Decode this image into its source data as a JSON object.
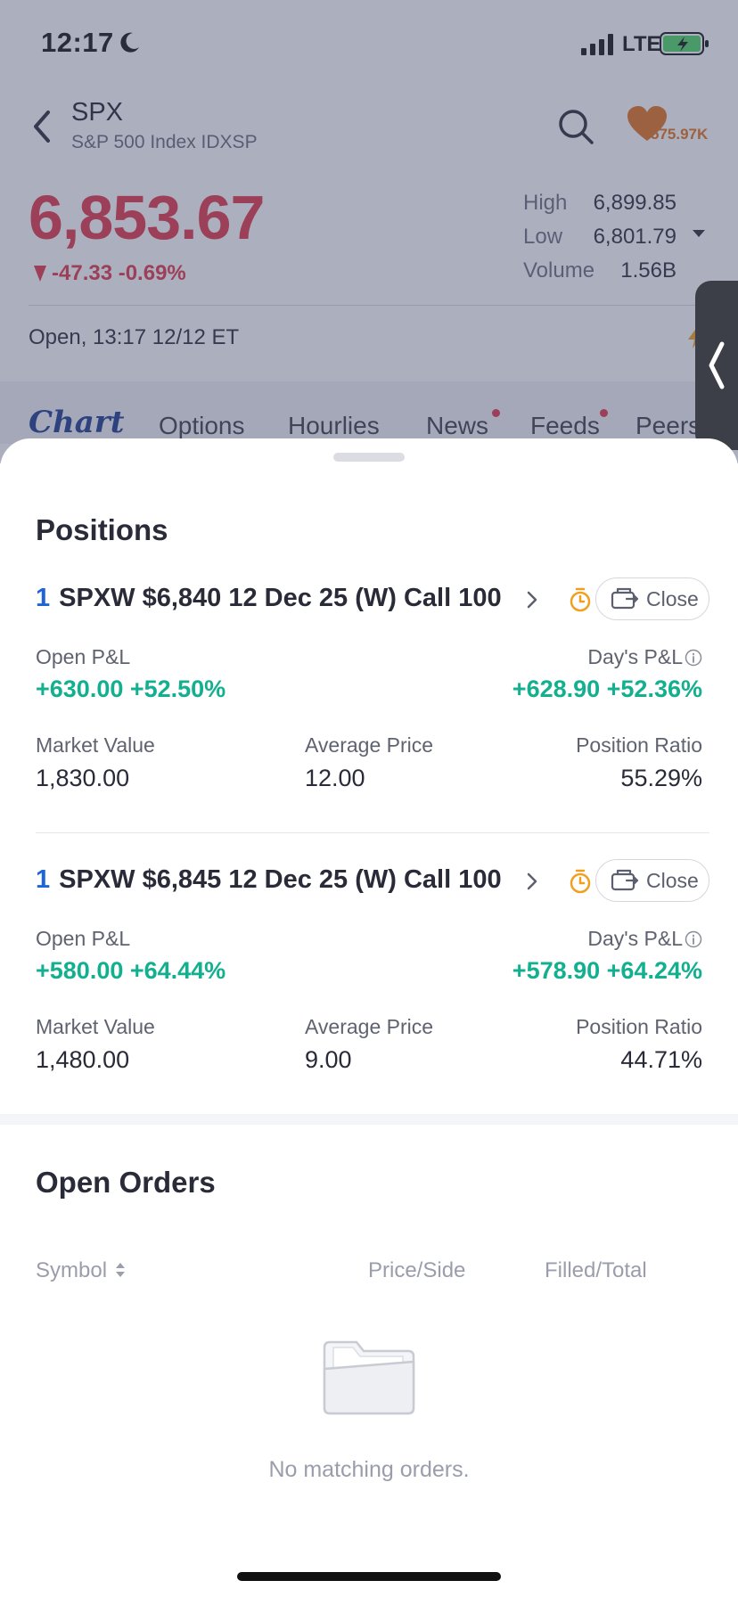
{
  "status_bar": {
    "time": "12:17",
    "network": "LTE"
  },
  "header": {
    "symbol": "SPX",
    "name": "S&P 500 Index IDXSP",
    "followers": "575.97K"
  },
  "quote": {
    "price": "6,853.67",
    "change": "-47.33 -0.69%",
    "stats": [
      {
        "label": "High",
        "value": "6,899.85"
      },
      {
        "label": "Low",
        "value": "6,801.79"
      },
      {
        "label": "Volume",
        "value": "1.56B"
      }
    ],
    "session": "Open, 13:17 12/12 ET"
  },
  "tabs": [
    "Chart",
    "Options",
    "Hourlies",
    "News",
    "Feeds",
    "Peers"
  ],
  "positions": {
    "title": "Positions",
    "items": [
      {
        "qty": "1",
        "contract": "SPXW $6,840 12 Dec 25 (W) Call 100",
        "close_label": "Close",
        "open_pl_label": "Open P&L",
        "open_pl": "+630.00 +52.50%",
        "days_pl_label": "Day's P&L",
        "days_pl": "+628.90 +52.36%",
        "market_value_label": "Market Value",
        "market_value": "1,830.00",
        "avg_price_label": "Average Price",
        "avg_price": "12.00",
        "ratio_label": "Position Ratio",
        "ratio": "55.29%"
      },
      {
        "qty": "1",
        "contract": "SPXW $6,845 12 Dec 25 (W) Call 100",
        "close_label": "Close",
        "open_pl_label": "Open P&L",
        "open_pl": "+580.00 +64.44%",
        "days_pl_label": "Day's P&L",
        "days_pl": "+578.90 +64.24%",
        "market_value_label": "Market Value",
        "market_value": "1,480.00",
        "avg_price_label": "Average Price",
        "avg_price": "9.00",
        "ratio_label": "Position Ratio",
        "ratio": "44.71%"
      }
    ]
  },
  "open_orders": {
    "title": "Open Orders",
    "columns": {
      "symbol": "Symbol",
      "price_side": "Price/Side",
      "filled_total": "Filled/Total"
    },
    "empty_text": "No matching orders."
  },
  "colors": {
    "price_down": "#e2334a",
    "gain": "#13b090",
    "qty_blue": "#1e64d8",
    "follow_orange": "#e2711d"
  }
}
